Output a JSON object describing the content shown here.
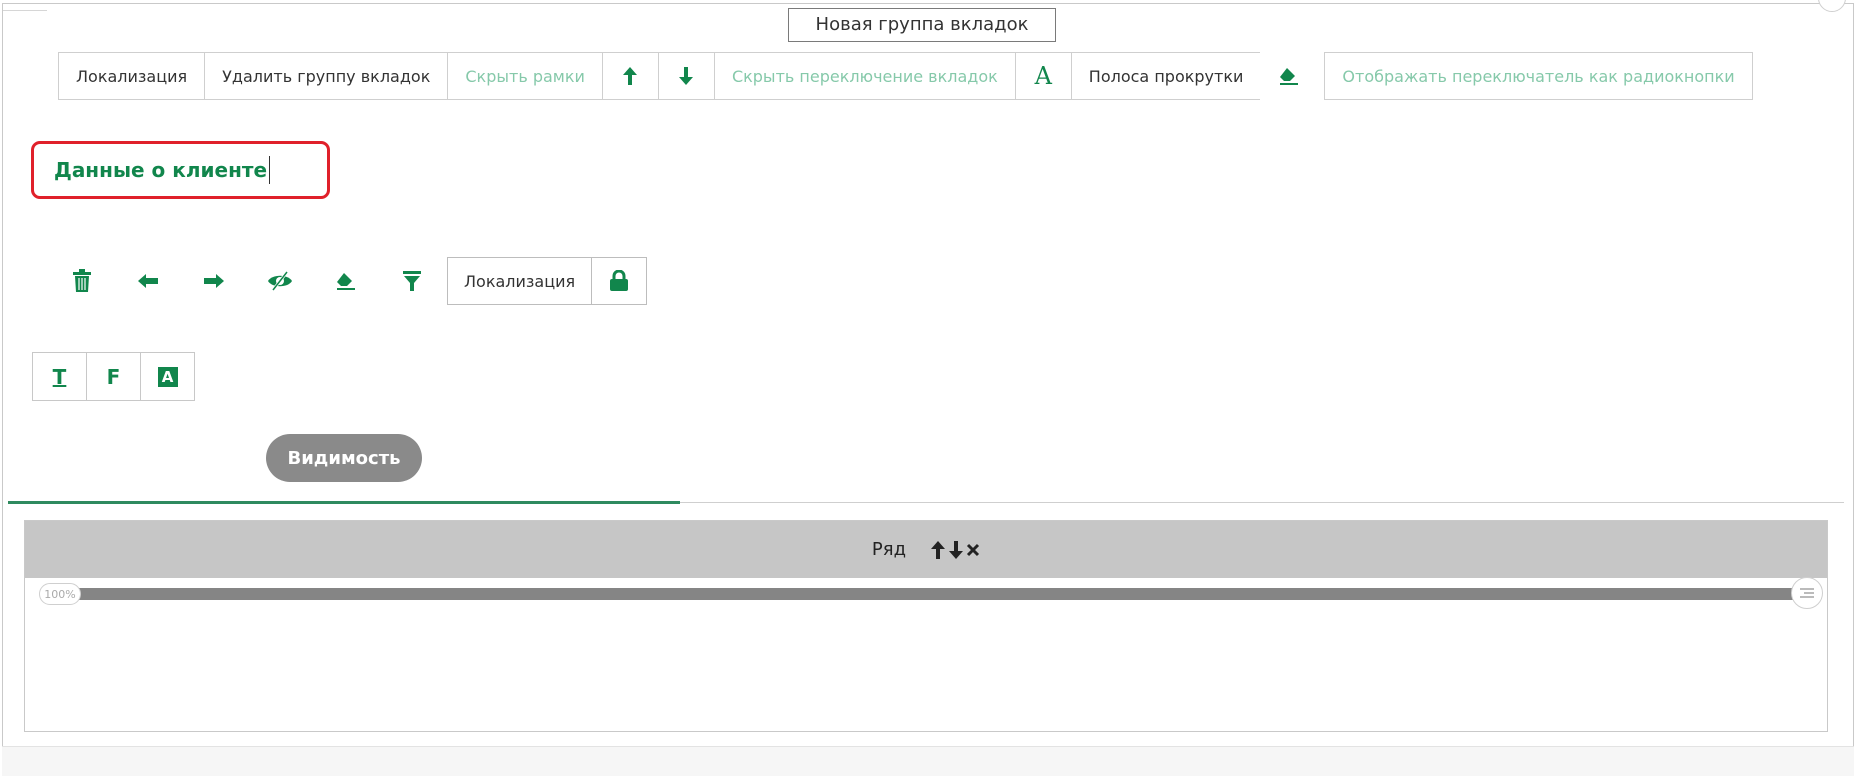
{
  "group_title": "Новая группа вкладок",
  "toolbar": {
    "localization": "Локализация",
    "delete_group": "Удалить группу вкладок",
    "hide_borders": "Скрыть рамки",
    "hide_tab_switch": "Скрыть переключение вкладок",
    "font_glyph": "A",
    "scrollbar": "Полоса прокрутки",
    "radio_switch": "Отображать переключатель как радиокнопки"
  },
  "tab_name_value": "Данные о клиенте",
  "tab_tools": {
    "localization": "Локализация"
  },
  "format_buttons": {
    "text": "T",
    "field": "F",
    "style": "A"
  },
  "visibility_label": "Видимость",
  "row": {
    "label": "Ряд",
    "width_percent": "100%"
  },
  "colors": {
    "accent": "#11864c",
    "highlight": "#e0202a",
    "pill": "#8a8a8a"
  }
}
